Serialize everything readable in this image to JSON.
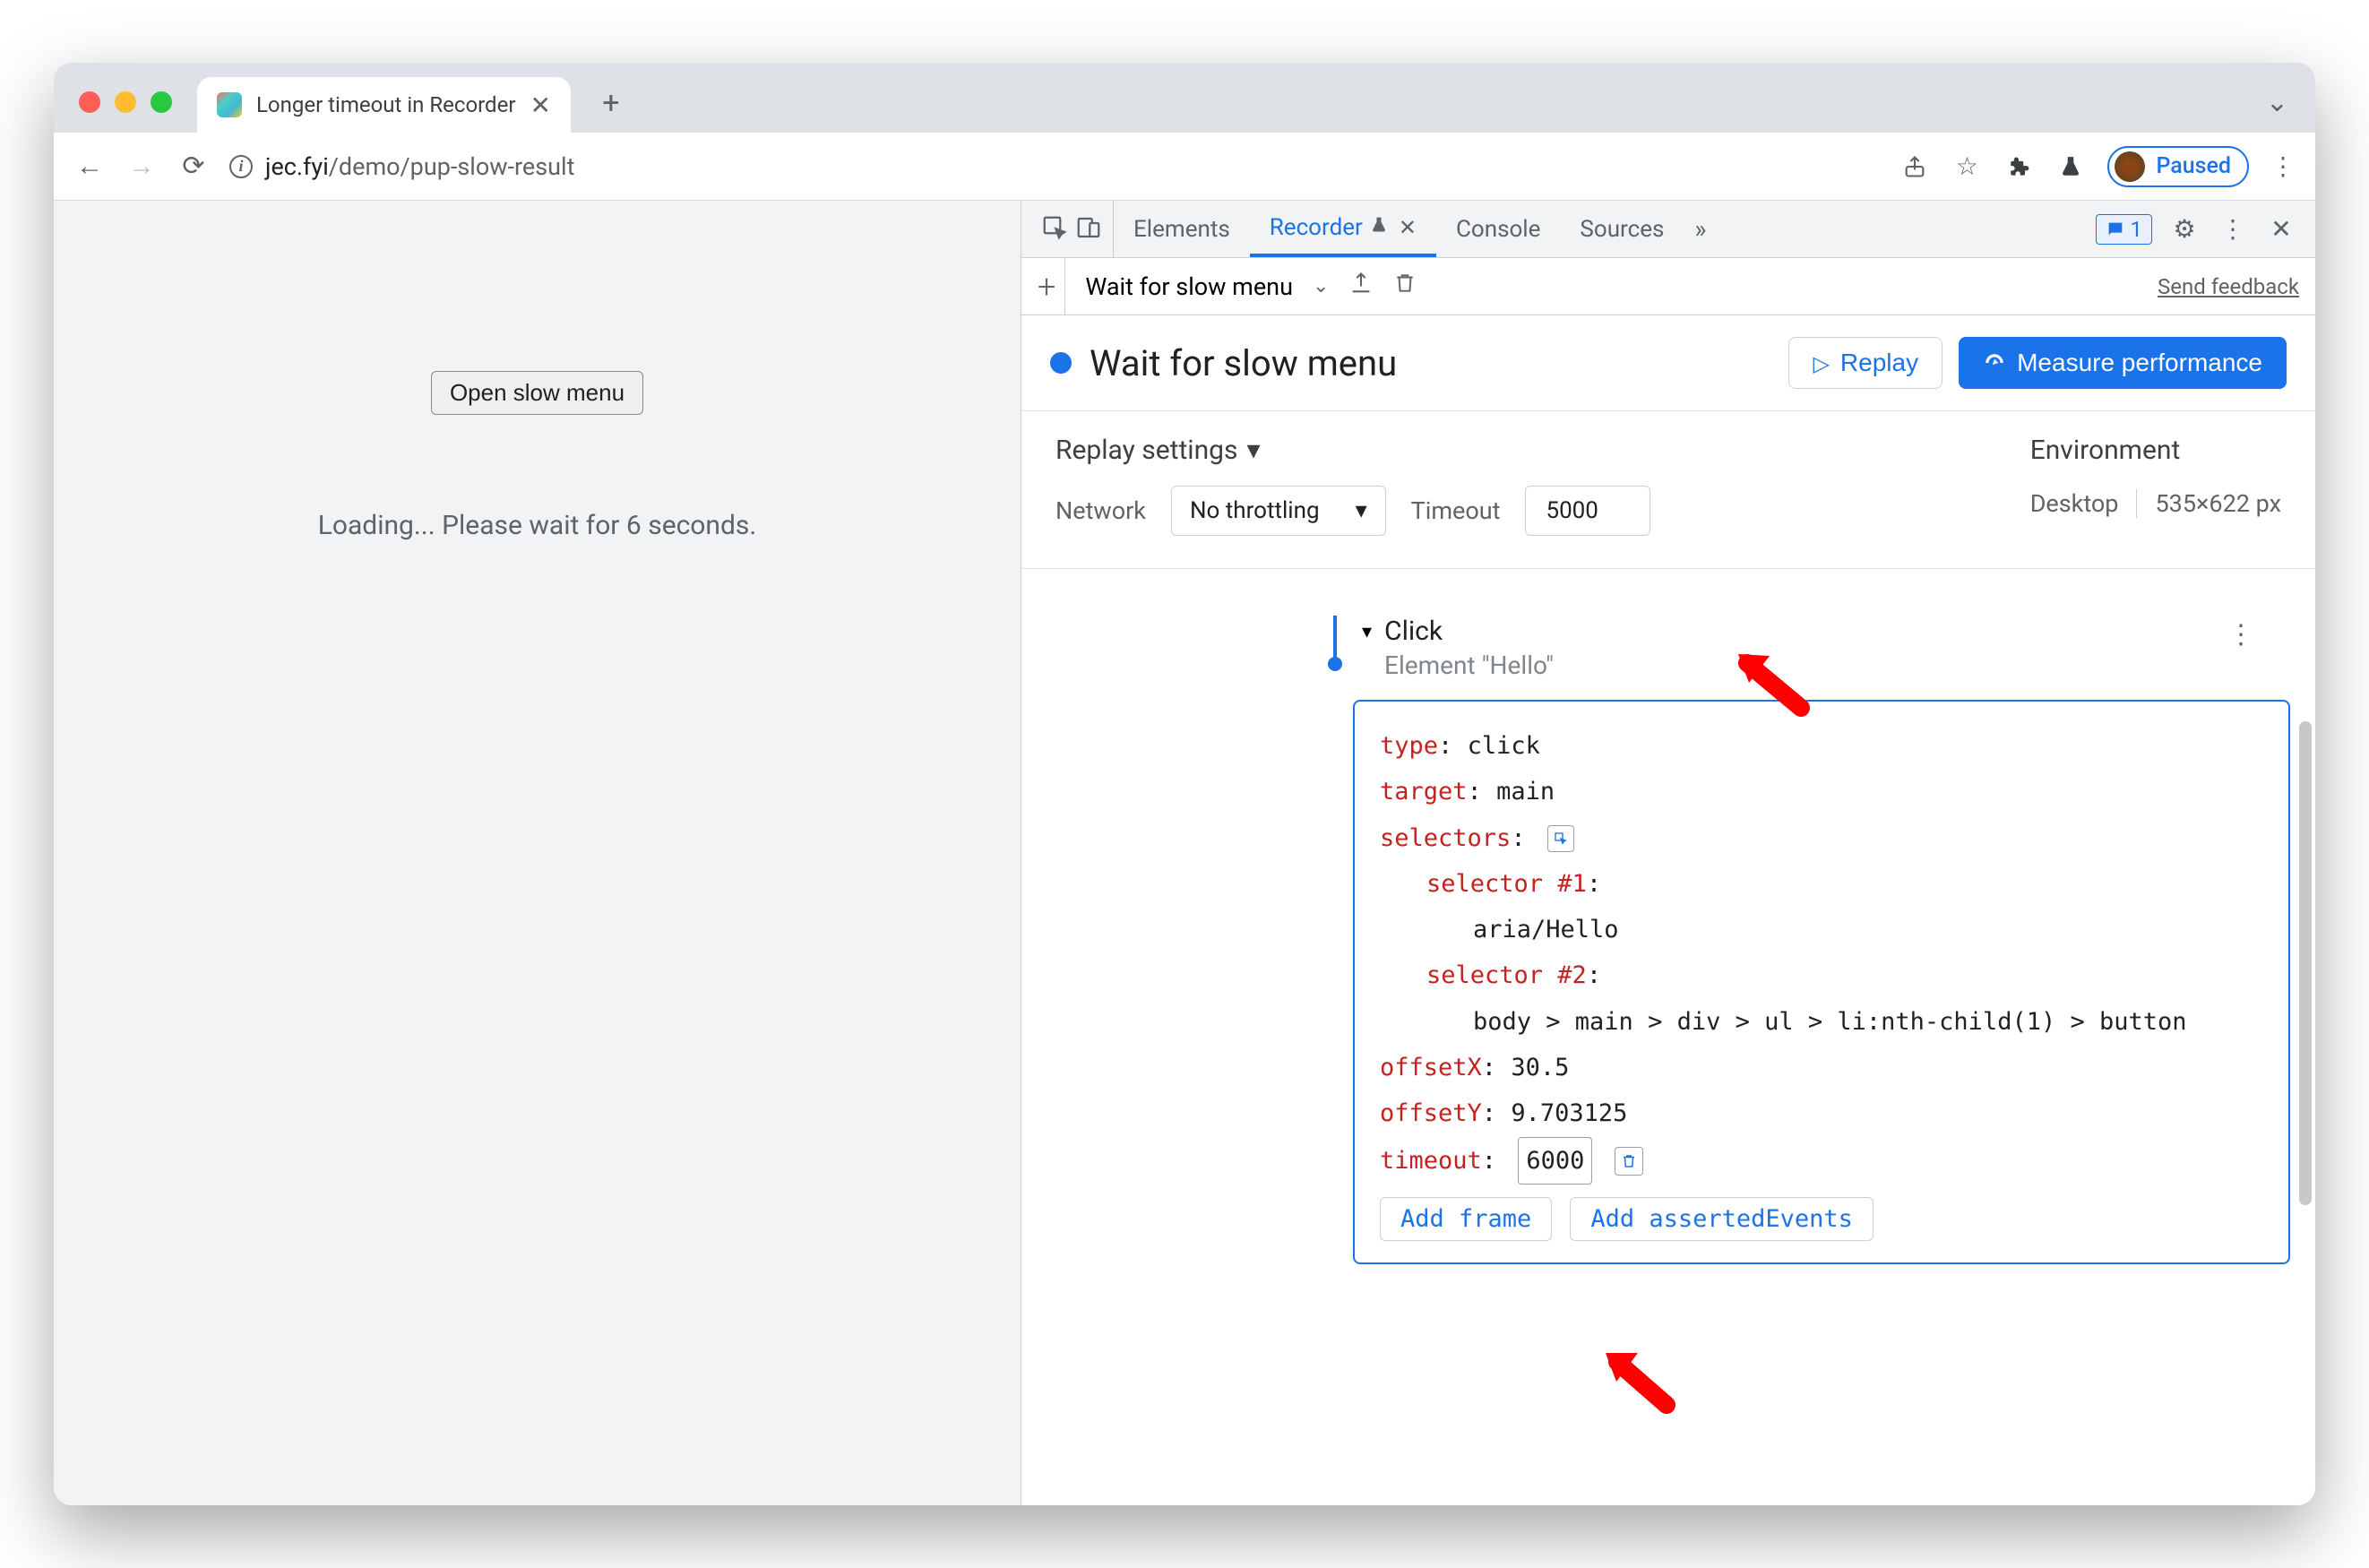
{
  "browser": {
    "tab_title": "Longer timeout in Recorder",
    "url_host": "jec.fyi",
    "url_path": "/demo/pup-slow-result",
    "paused_label": "Paused"
  },
  "page": {
    "button_label": "Open slow menu",
    "loading_text": "Loading... Please wait for 6 seconds."
  },
  "devtools": {
    "tabs": {
      "elements": "Elements",
      "recorder": "Recorder",
      "console": "Console",
      "sources": "Sources"
    },
    "issues_count": "1",
    "recorder": {
      "recording_name": "Wait for slow menu",
      "send_feedback": "Send feedback",
      "title": "Wait for slow menu",
      "replay_label": "Replay",
      "measure_label": "Measure performance",
      "settings_title": "Replay settings",
      "network_label": "Network",
      "network_value": "No throttling",
      "timeout_label": "Timeout",
      "timeout_value": "5000",
      "environment_title": "Environment",
      "env_device": "Desktop",
      "env_size": "535×622 px",
      "step": {
        "title": "Click",
        "subtitle": "Element \"Hello\"",
        "props": {
          "type_k": "type",
          "type_v": "click",
          "target_k": "target",
          "target_v": "main",
          "selectors_k": "selectors",
          "sel1_k": "selector #1",
          "sel1_v": "aria/Hello",
          "sel2_k": "selector #2",
          "sel2_v": "body > main > div > ul > li:nth-child(1) > button",
          "offx_k": "offsetX",
          "offx_v": "30.5",
          "offy_k": "offsetY",
          "offy_v": "9.703125",
          "timeout_k": "timeout",
          "timeout_v": "6000"
        },
        "add_frame": "Add frame",
        "add_asserted": "Add assertedEvents"
      }
    }
  },
  "glyphs": {
    "chevron_down": "⌄",
    "caret_down_filled": "▾",
    "caret_down_small": "▾",
    "close_x": "✕",
    "plus": "+",
    "back": "←",
    "fwd": "→",
    "reload": "⟳",
    "share": "⇪",
    "star": "☆",
    "puzzle": "✦",
    "flask": "⚗",
    "kebab": "⋮",
    "gear": "⚙",
    "speech": "❐",
    "dbl_chevron": "»",
    "upload": "⤴",
    "trash": "🗑",
    "colon": ":"
  }
}
